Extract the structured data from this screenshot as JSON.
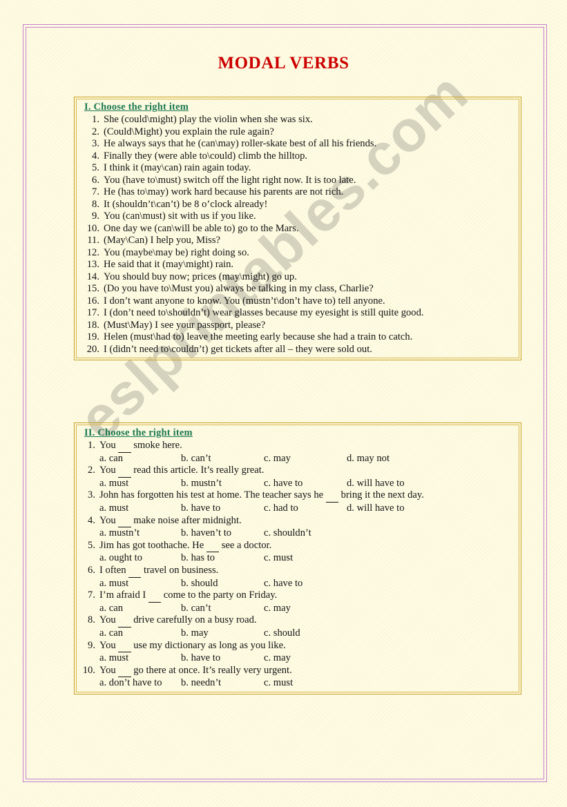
{
  "document": {
    "title": "MODAL VERBS",
    "title_color": "#cc0000",
    "watermark": "eslprintables.com",
    "page_background": "#fefce8",
    "frame_color": "#c77fd0",
    "box_border_color": "#c8a020",
    "heading_color": "#1d7a52"
  },
  "part_one": {
    "heading": "I. Choose the right item",
    "items": [
      {
        "num": "1.",
        "text": "She (could\\might) play the violin when she was six."
      },
      {
        "num": "2.",
        "text": "(Could\\Might) you explain the rule again?"
      },
      {
        "num": "3.",
        "text": "He always says that he (can\\may) roller-skate best of all his friends."
      },
      {
        "num": "4.",
        "text": "Finally they (were able to\\could) climb the hilltop."
      },
      {
        "num": "5.",
        "text": "I think it (may\\can) rain again today."
      },
      {
        "num": "6.",
        "text": "You (have to\\must) switch off the light right now. It is too late."
      },
      {
        "num": "7.",
        "text": "He (has to\\may) work hard because his parents are not rich."
      },
      {
        "num": "8.",
        "text": "It (shouldn’t\\can’t) be 8 o’clock already!"
      },
      {
        "num": "9.",
        "text": "You (can\\must) sit with us if you like."
      },
      {
        "num": "10.",
        "text": "One day we (can\\will be able to) go to the Mars."
      },
      {
        "num": "11.",
        "text": "(May\\Can) I help you, Miss?"
      },
      {
        "num": "12.",
        "text": "You (maybe\\may be) right doing so."
      },
      {
        "num": "13.",
        "text": "He said that it (may\\might) rain."
      },
      {
        "num": "14.",
        "text": "You should buy now; prices (may\\might) go up."
      },
      {
        "num": "15.",
        "text": "(Do you have to\\Must you) always be talking in my class, Charlie?"
      },
      {
        "num": "16.",
        "text": "I don’t want anyone to know.  You (mustn’t\\don’t have to) tell anyone."
      },
      {
        "num": "17.",
        "text": "I  (don’t need to\\shouldn’t) wear glasses  because my eyesight is still quite good."
      },
      {
        "num": "18.",
        "text": "(Must\\May) I see your passport, please?"
      },
      {
        "num": "19.",
        "text": "Helen (must\\had to) leave the meeting early because she had a train to catch."
      },
      {
        "num": "20.",
        "text": "I (didn’t need to\\couldn’t) get tickets after all – they were sold out."
      }
    ]
  },
  "part_two": {
    "heading": "II. Choose the right item",
    "questions": [
      {
        "num": "1.",
        "before": "You ",
        "after": " smoke here.",
        "options": [
          "a. can",
          "b. can’t",
          "c. may",
          "d. may not"
        ]
      },
      {
        "num": "2.",
        "before": "You ",
        "after": " read this article. It’s really great.",
        "options": [
          "a. must",
          "b. mustn’t",
          "c. have to",
          "d. will have to"
        ]
      },
      {
        "num": "3.",
        "before": "John has forgotten his test at home. The teacher says he ",
        "after": " bring it the next day.",
        "options": [
          "a. must",
          "b. have to",
          "c. had to",
          "d. will have to"
        ]
      },
      {
        "num": "4.",
        "before": "You ",
        "after": " make noise after midnight.",
        "options": [
          "a. mustn’t",
          "b. haven’t to",
          "c. shouldn’t"
        ]
      },
      {
        "num": "5.",
        "before": "Jim has got toothache. He ",
        "after": " see a doctor.",
        "options": [
          "a. ought to",
          "b. has to",
          "c. must"
        ]
      },
      {
        "num": "6.",
        "before": "I often ",
        "after": " travel on  business.",
        "options": [
          "a. must",
          "b. should",
          "c. have to"
        ]
      },
      {
        "num": "7.",
        "before": "I’m afraid I ",
        "after": " come to the party on Friday.",
        "options": [
          "a. can",
          "b. can’t",
          "c. may"
        ]
      },
      {
        "num": "8.",
        "before": "You ",
        "after": " drive carefully on a busy road.",
        "options": [
          "a. can",
          "b. may",
          "c. should"
        ]
      },
      {
        "num": "9.",
        "before": "You ",
        "after": " use my dictionary as long as you like.",
        "options": [
          "a. must",
          "b. have to",
          "c. may"
        ]
      },
      {
        "num": "10.",
        "before": "You ",
        "after": " go there at once. It’s really very urgent.",
        "options": [
          "a. don’t have to",
          "b. needn’t",
          "c. must"
        ]
      }
    ]
  }
}
